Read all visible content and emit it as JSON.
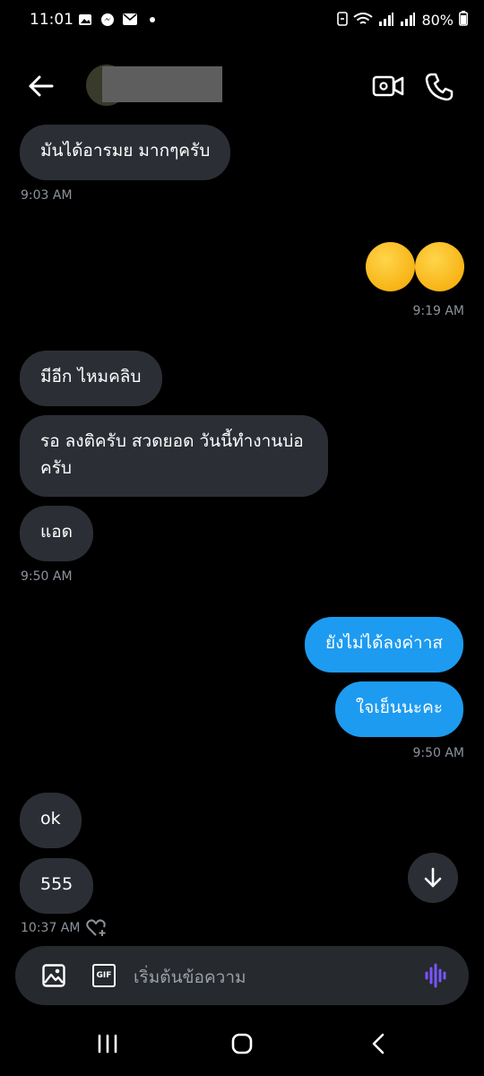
{
  "status_bar": {
    "time": "11:01",
    "battery": "80%"
  },
  "header": {
    "icons": [
      "back-arrow-icon",
      "video-call-icon",
      "phone-icon"
    ]
  },
  "messages": {
    "m1": "มันได้อารมย มากๆครับ",
    "t1": "9:03 AM",
    "t2": "9:19 AM",
    "m3": "มีอีก ไหมคลิบ",
    "m4_line1": "รอ ลงติครับ สวดยอด วันนี้ทำงานบ่อ",
    "m4_line2": "ครับ",
    "m5": "แอด",
    "t3": "9:50 AM",
    "s1": "ยังไม่ได้ลงค่าาส",
    "s2": "ใจเย็นนะคะ",
    "t4": "9:50 AM",
    "m6": "ok",
    "m7": "555",
    "t5": "10:37 AM"
  },
  "composer": {
    "placeholder": "เริ่มต้นข้อความ",
    "gif_label": "GIF"
  },
  "colors": {
    "background": "#000000",
    "received_bubble": "#2b2f35",
    "sent_bubble": "#1d9bf0",
    "timestamp": "#8b939c",
    "voice_accent": "#7856ff"
  }
}
